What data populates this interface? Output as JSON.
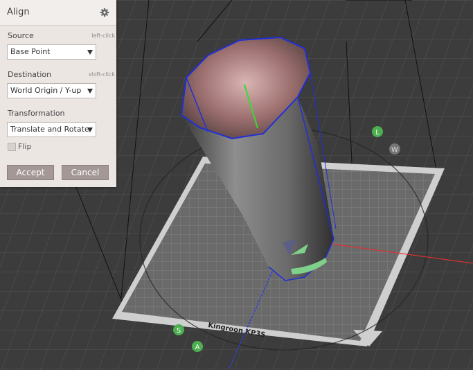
{
  "panel": {
    "title": "Align",
    "icon": "gear-icon",
    "source": {
      "label": "Source",
      "hint": "left-click",
      "value": "Base Point"
    },
    "destination": {
      "label": "Destination",
      "hint": "shift-click",
      "value": "World Origin / Y-up"
    },
    "transformation": {
      "label": "Transformation",
      "value": "Translate and Rotate"
    },
    "flip": {
      "label": "Flip",
      "checked": false
    },
    "accept_label": "Accept",
    "cancel_label": "Cancel"
  },
  "scene": {
    "printer_name": "Kingroon KP3S",
    "nav_markers": [
      "L",
      "W",
      "S",
      "A"
    ],
    "colors": {
      "background": "#3c3c3c",
      "selection_edge": "#1f2fd8",
      "x_axis": "#e03030",
      "z_axis": "#3040e0",
      "normal": "#33dd33",
      "gizmo": "#7fd08a"
    }
  }
}
